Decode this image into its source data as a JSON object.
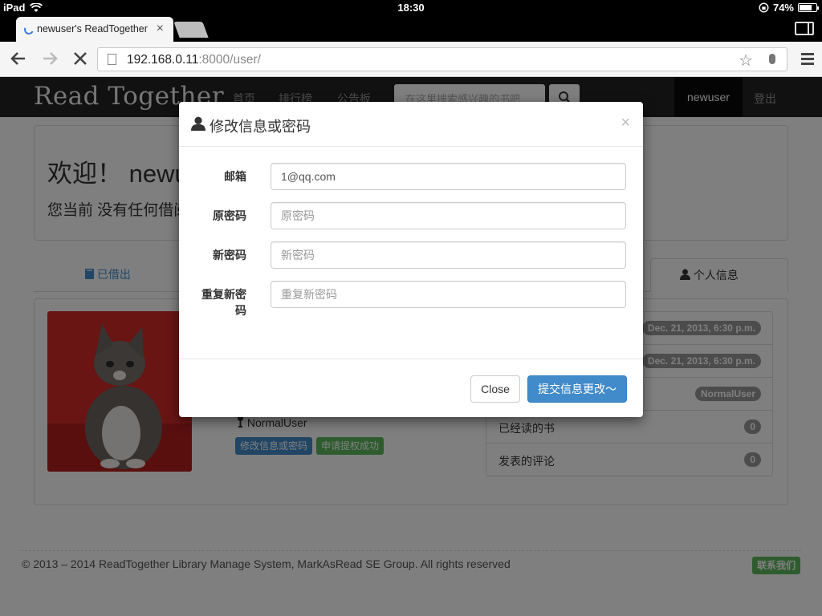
{
  "status_bar": {
    "device": "iPad",
    "time": "18:30",
    "battery": "74%",
    "battery_level": 0.74
  },
  "browser": {
    "tab_title": "newuser's ReadTogether",
    "tab_close": "×",
    "url_host": "192.168.0.11",
    "url_rest": ":8000/user/",
    "icons": [
      "back-arrow-icon",
      "forward-arrow-icon",
      "stop-icon",
      "page-icon",
      "star-icon",
      "mic-icon",
      "menu-icon",
      "sidebar-toggle-icon"
    ]
  },
  "navbar": {
    "brand": "Read Together",
    "links": [
      "首页",
      "排行榜",
      "公告板"
    ],
    "search_placeholder": "在这里搜索感兴趣的书吧",
    "user": "newuser",
    "logout": "登出"
  },
  "jumbotron": {
    "title": "欢迎！ newuser",
    "subtitle": "您当前 没有任何借阅"
  },
  "tabs": {
    "borrowed": "已借出",
    "profile": "个人信息"
  },
  "profile": {
    "role": "NormalUser",
    "edit_button": "修改信息或密码",
    "apply_button": "申请提权成功",
    "list": [
      {
        "label": "",
        "badge": "Dec. 21, 2013, 6:30 p.m."
      },
      {
        "label": "",
        "badge": "Dec. 21, 2013, 6:30 p.m."
      },
      {
        "label": "",
        "badge": "NormalUser"
      },
      {
        "label": "已经读的书",
        "badge": "0"
      },
      {
        "label": "发表的评论",
        "badge": "0"
      }
    ]
  },
  "footer": {
    "copyright": "© 2013 – 2014 ReadTogether Library Manage System, MarkAsRead SE Group. All rights reserved",
    "contact": "联系我们"
  },
  "modal": {
    "title": "修改信息或密码",
    "close_x": "×",
    "fields": [
      {
        "label": "邮箱",
        "value": "1@qq.com",
        "placeholder": ""
      },
      {
        "label": "原密码",
        "value": "",
        "placeholder": "原密码"
      },
      {
        "label": "新密码",
        "value": "",
        "placeholder": "新密码"
      },
      {
        "label": "重复新密码",
        "value": "",
        "placeholder": "重复新密码"
      }
    ],
    "close_button": "Close",
    "submit_button": "提交信息更改～"
  },
  "colors": {
    "primary": "#428bca",
    "success": "#5cb85c",
    "navbar": "#222222",
    "badge": "#999999"
  }
}
